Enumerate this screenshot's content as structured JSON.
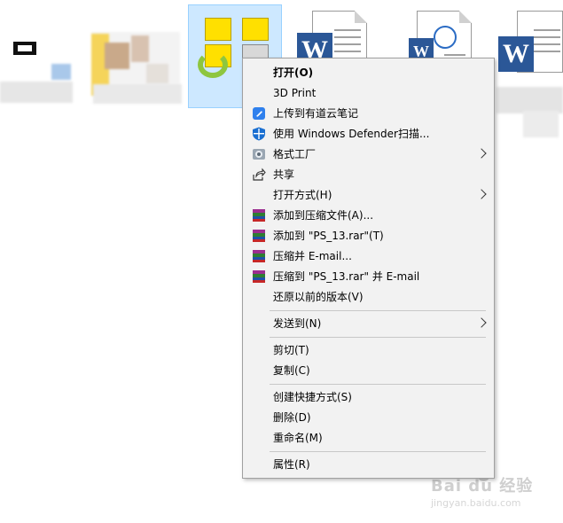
{
  "menu": {
    "items": [
      {
        "label": "打开(O)",
        "icon": "none",
        "bold": true
      },
      {
        "label": "3D Print",
        "icon": "none"
      },
      {
        "label": "上传到有道云笔记",
        "icon": "youdao-cloud-note-icon"
      },
      {
        "label": "使用 Windows Defender扫描...",
        "icon": "windows-defender-shield-icon"
      },
      {
        "label": "格式工厂",
        "icon": "format-factory-icon",
        "submenu": true
      },
      {
        "label": "共享",
        "icon": "share-icon"
      },
      {
        "label": "打开方式(H)",
        "icon": "none",
        "submenu": true
      },
      {
        "label": "添加到压缩文件(A)...",
        "icon": "winrar-icon"
      },
      {
        "label": "添加到 \"PS_13.rar\"(T)",
        "icon": "winrar-icon"
      },
      {
        "label": "压缩并 E-mail...",
        "icon": "winrar-icon"
      },
      {
        "label": "压缩到 \"PS_13.rar\" 并 E-mail",
        "icon": "winrar-icon"
      },
      {
        "label": "还原以前的版本(V)",
        "icon": "none"
      },
      {
        "label": "发送到(N)",
        "icon": "none",
        "submenu": true
      },
      {
        "label": "剪切(T)",
        "icon": "none"
      },
      {
        "label": "复制(C)",
        "icon": "none"
      },
      {
        "label": "创建快捷方式(S)",
        "icon": "none"
      },
      {
        "label": "删除(D)",
        "icon": "none"
      },
      {
        "label": "重命名(M)",
        "icon": "none"
      },
      {
        "label": "属性(R)",
        "icon": "none"
      }
    ]
  },
  "watermark": {
    "brand": "Bai du 经验",
    "url": "jingyan.baidu.com"
  },
  "desktop": {
    "word_badge": "W"
  },
  "colors": {
    "menu_bg": "#f2f2f2",
    "selection_bg": "#cde8ff",
    "word_blue": "#2b5797",
    "defender_blue": "#1a6fd1",
    "youdao_blue": "#2f80ed"
  }
}
